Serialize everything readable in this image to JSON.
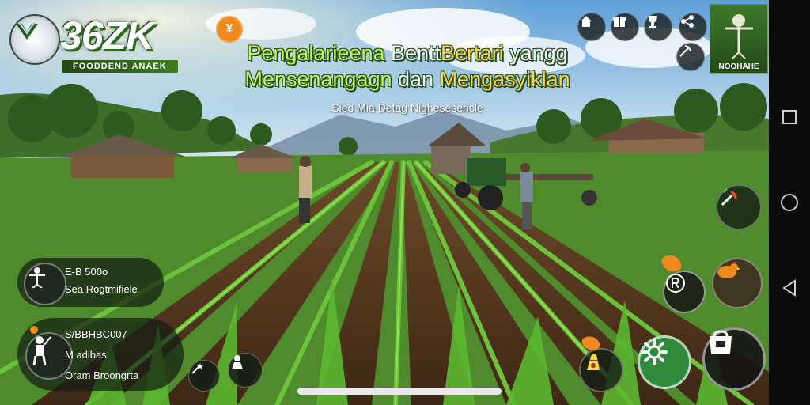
{
  "logo": {
    "title": "36ZK",
    "subtitle": "FOODDEND ANAEK"
  },
  "headline": {
    "line1_a": "Pengalarieena ",
    "line1_b": "Bentt",
    "line1_c": "Bertari",
    "line1_d": " yangg",
    "line2_a": "Mensenangagn",
    "line2_b": " dan ",
    "line2_c": "Mengasyiklan",
    "line3": "Sied Mia Detag Nighesesencle"
  },
  "top_badge": "¥",
  "map": {
    "label": "NOOHAHE"
  },
  "left_panel_1": {
    "line1": "E-B 500o",
    "line2": "Sea Rogtmifiele"
  },
  "left_panel_2": {
    "line1": "S/BBHBC007",
    "line2": "M adibas",
    "line3": "Oram Broongrta"
  },
  "icons": {
    "top_row": [
      "house-icon",
      "gift-icon",
      "trophy-icon",
      "share-icon",
      "pickaxe-icon"
    ],
    "right_column": [
      "harvest-icon",
      "chicken-icon",
      "tractor-icon",
      "settings-icon",
      "shop-icon"
    ],
    "bottom_left": [
      "wand-icon",
      "farmer-icon"
    ]
  },
  "colors": {
    "accent_green": "#c8f25a",
    "accent_gold": "#ffd34a",
    "badge_orange": "#f08a1e",
    "panel_dark": "#1e2a1e"
  }
}
